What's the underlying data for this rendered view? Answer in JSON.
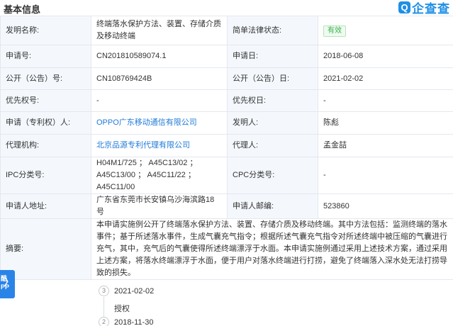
{
  "header": {
    "title": "基本信息",
    "logo_mark": "Q",
    "logo_text": "企查查"
  },
  "rows": {
    "invention_name": {
      "label": "发明名称:",
      "value": "终端落水保护方法、装置、存储介质及移动终端"
    },
    "legal_status": {
      "label": "简单法律状态:",
      "value": "有效"
    },
    "app_no": {
      "label": "申请号:",
      "value": "CN201810589074.1"
    },
    "app_date": {
      "label": "申请日:",
      "value": "2018-06-08"
    },
    "pub_no": {
      "label": "公开（公告）号:",
      "value": "CN108769424B"
    },
    "pub_date": {
      "label": "公开（公告）日:",
      "value": "2021-02-02"
    },
    "priority_no": {
      "label": "优先权号:",
      "value": "-"
    },
    "priority_date": {
      "label": "优先权日:",
      "value": "-"
    },
    "applicant": {
      "label": "申请（专利权）人:",
      "value": "OPPO广东移动通信有限公司"
    },
    "inventor": {
      "label": "发明人:",
      "value": "陈彪"
    },
    "agency": {
      "label": "代理机构:",
      "value": "北京品源专利代理有限公司"
    },
    "agent": {
      "label": "代理人:",
      "value": "孟金喆"
    },
    "ipc": {
      "label": "IPC分类号:",
      "value": "H04M1/725 ； A45C13/02 ； A45C13/00 ； A45C11/22 ； A45C11/00"
    },
    "cpc": {
      "label": "CPC分类号:",
      "value": "-"
    },
    "address": {
      "label": "申请人地址:",
      "value": "广东省东莞市长安镇乌沙海滨路18号"
    },
    "postcode": {
      "label": "申请人邮编:",
      "value": "523860"
    },
    "abstract": {
      "label": "摘要:",
      "value": "本申请实施例公开了终端落水保护方法、装置、存储介质及移动终端。其中方法包括：监测终端的落水事件；基于所述落水事件，生成气囊充气指令；根据所述气囊充气指令对所述终端中被压缩的气囊进行充气，其中，充气后的气囊使得所述终端漂浮于水面。本申请实施例通过采用上述技术方案，通过采用上述方案，将落水终端漂浮于水面，便于用户对落水终端进行打捞，避免了终端落入深水处无法打捞导致的损失。"
    }
  },
  "float_tab": {
    "line1": "酷",
    "line2": "PP",
    "chevron": "〉"
  },
  "timeline": [
    {
      "num": "3",
      "date": "2021-02-02",
      "text": "授权"
    },
    {
      "num": "2",
      "date": "2018-11-30",
      "text": ""
    }
  ]
}
